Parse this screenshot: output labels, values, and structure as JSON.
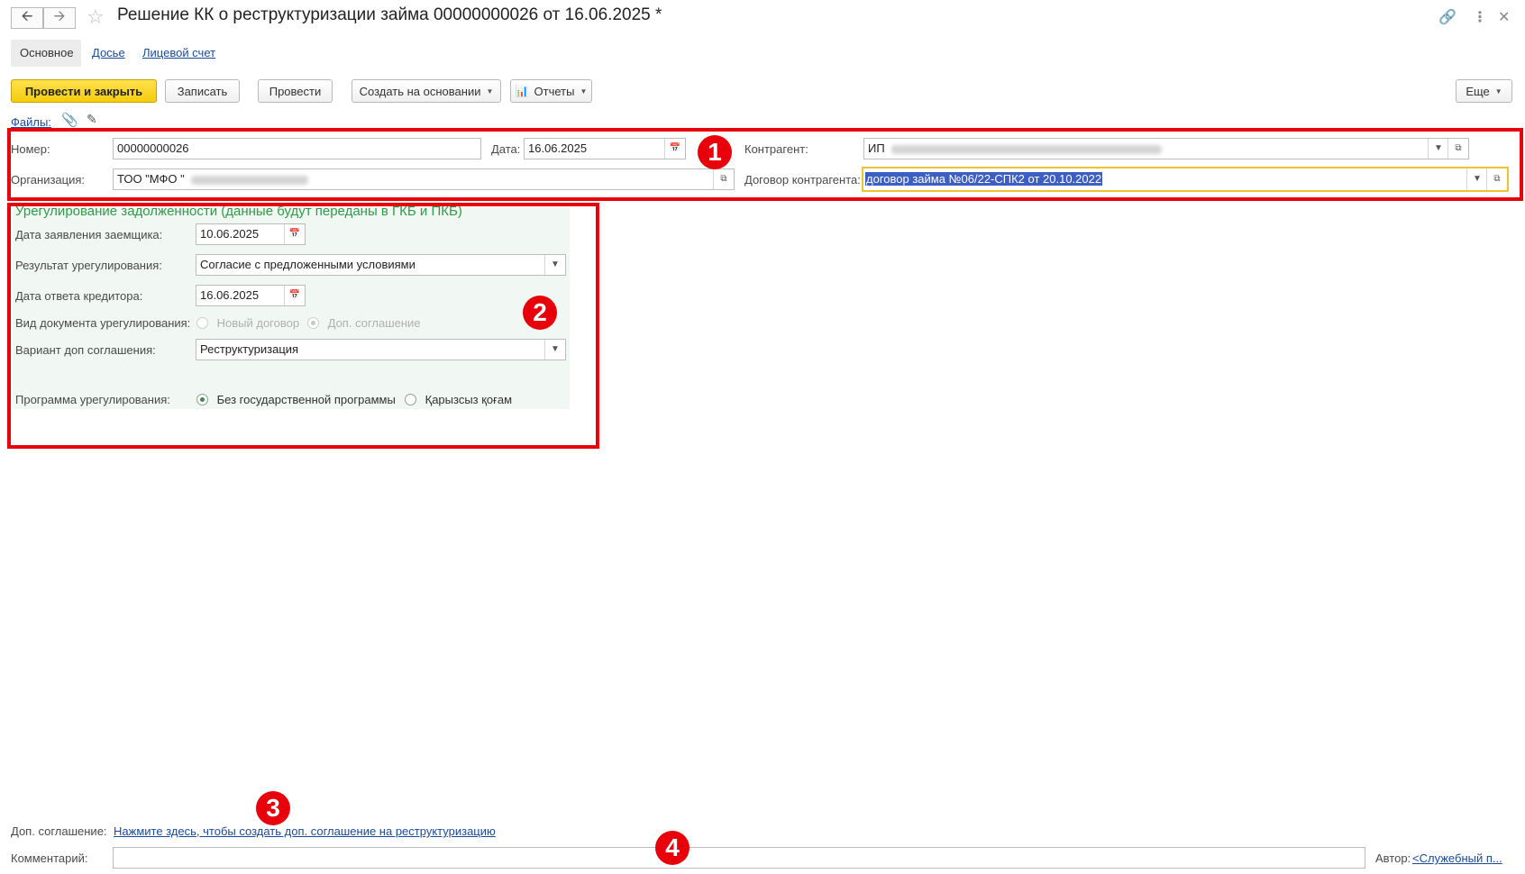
{
  "window": {
    "title": "Решение КК о реструктуризации займа 00000000026 от 16.06.2025 *"
  },
  "tabs": [
    {
      "label": "Основное"
    },
    {
      "label": "Досье"
    },
    {
      "label": "Лицевой счет"
    }
  ],
  "toolbar": {
    "post_close": "Провести и закрыть",
    "save": "Записать",
    "post": "Провести",
    "create_based": "Создать на основании",
    "reports": "Отчеты",
    "more": "Еще"
  },
  "files": {
    "label": "Файлы:"
  },
  "header": {
    "number_label": "Номер:",
    "number_value": "00000000026",
    "date_label": "Дата:",
    "date_value": "16.06.2025",
    "counterparty_label": "Контрагент:",
    "counterparty_value": "ИП",
    "org_label": "Организация:",
    "org_value": "ТОО \"МФО \"",
    "contract_label": "Договор контрагента:",
    "contract_value": "договор займа №06/22-СПК2 от 20.10.2022"
  },
  "settlement": {
    "title": "Урегулирование задолженности (данные будут переданы в ГКБ и ПКБ)",
    "app_date_label": "Дата заявления заемщика:",
    "app_date_value": "10.06.2025",
    "result_label": "Результат урегулирования:",
    "result_value": "Согласие с предложенными условиями",
    "reply_date_label": "Дата ответа кредитора:",
    "reply_date_value": "16.06.2025",
    "doc_type_label": "Вид документа урегулирования:",
    "doc_type_options": [
      "Новый договор",
      "Доп. соглашение"
    ],
    "doc_type_selected": "Доп. соглашение",
    "variant_label": "Вариант доп соглашения:",
    "variant_value": "Реструктуризация",
    "program_label": "Программа урегулирования:",
    "program_options": [
      "Без государственной программы",
      "Қарызсыз қоғам"
    ],
    "program_selected": "Без государственной программы"
  },
  "footer": {
    "addendum_label": "Доп. соглашение:",
    "addendum_link": "Нажмите здесь, чтобы создать доп. соглашение на реструктуризацию",
    "comment_label": "Комментарий:",
    "comment_value": "",
    "author_label": "Автор:",
    "author_value": "<Служебный п..."
  },
  "markers": [
    "1",
    "2",
    "3",
    "4"
  ],
  "colors": {
    "highlight_red": "#e8000b",
    "primary_yellow": "#f5cc0d",
    "section_green": "#2f9c48",
    "link_blue": "#1a4a9c",
    "selection_blue": "#3d5fc4"
  },
  "icons": [
    "back-arrow-icon",
    "forward-arrow-icon",
    "star-icon",
    "link-icon",
    "more-vertical-icon",
    "close-icon",
    "paperclip-icon",
    "pen-icon",
    "calendar-icon",
    "dropdown-icon",
    "open-icon",
    "report-icon"
  ]
}
